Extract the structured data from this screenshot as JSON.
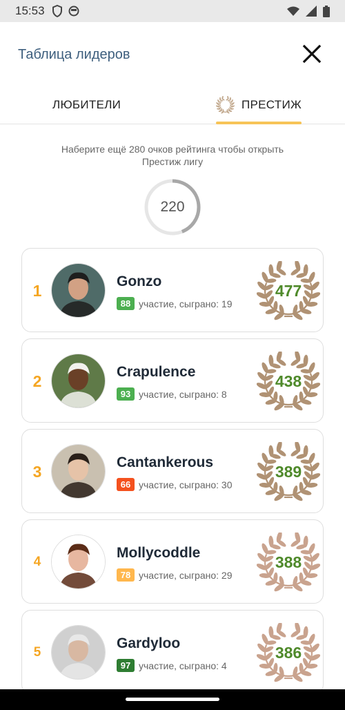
{
  "status_bar": {
    "time": "15:53"
  },
  "header": {
    "title": "Таблица лидеров"
  },
  "tabs": [
    {
      "label": "ЛЮБИТЕЛИ",
      "active": false
    },
    {
      "label": "ПРЕСТИЖ",
      "active": true
    }
  ],
  "progress": {
    "hint_line1": "Наберите ещё 280 очков рейтинга чтобы открыть",
    "hint_line2": "Престиж лигу",
    "value": "220",
    "target": 500,
    "fraction": 0.44
  },
  "leaders": [
    {
      "rank": "1",
      "name": "Gonzo",
      "badge": "88",
      "badge_color": "#4caf50",
      "meta": "участие, сыграно: 19",
      "score": "477",
      "laurel_color": "#b09274",
      "avatar_skin": "#d2a184",
      "avatar_bg": "#4f6b68",
      "avatar_hair": "#1e1e1e"
    },
    {
      "rank": "2",
      "name": "Crapulence",
      "badge": "93",
      "badge_color": "#4caf50",
      "meta": "участие, сыграно: 8",
      "score": "438",
      "laurel_color": "#b09274",
      "avatar_skin": "#6a4027",
      "avatar_bg": "#5f7a48",
      "avatar_hair": "#f2f2ee"
    },
    {
      "rank": "3",
      "name": "Cantankerous",
      "badge": "66",
      "badge_color": "#f4511e",
      "meta": "участие, сыграно: 30",
      "score": "389",
      "laurel_color": "#b09274",
      "avatar_skin": "#e6c3a8",
      "avatar_bg": "#c9c0b0",
      "avatar_hair": "#2a201a"
    },
    {
      "rank": "4",
      "name": "Mollycoddle",
      "badge": "78",
      "badge_color": "#ffb74d",
      "meta": "участие, сыграно: 29",
      "score": "388",
      "laurel_color": "#c9a38e",
      "avatar_skin": "#e7b7a0",
      "avatar_bg": "#ffffff",
      "avatar_hair": "#5b2c17"
    },
    {
      "rank": "5",
      "name": "Gardyloo",
      "badge": "97",
      "badge_color": "#2e7d32",
      "meta": "участие, сыграно: 4",
      "score": "386",
      "laurel_color": "#c9a38e",
      "avatar_skin": "#d8b8a2",
      "avatar_bg": "#d0d0d0",
      "avatar_hair": "#e8e8e8"
    }
  ]
}
